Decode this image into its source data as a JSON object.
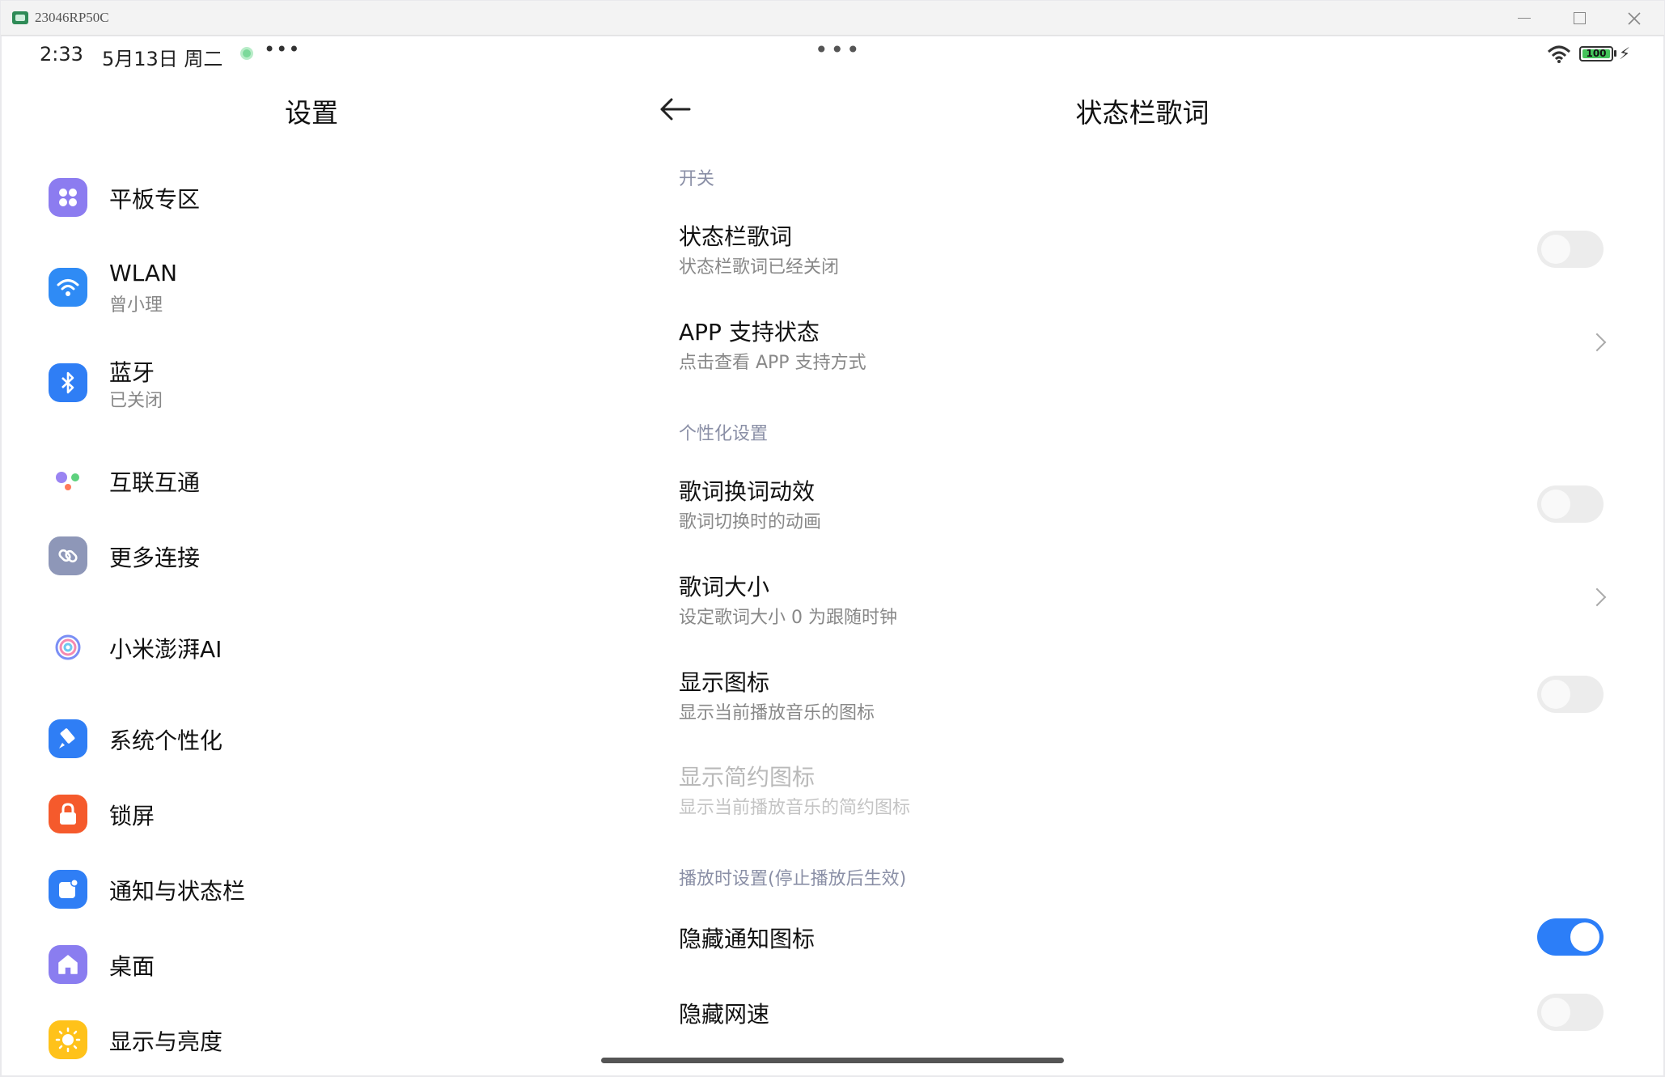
{
  "window": {
    "title": "23046RP50C"
  },
  "statusbar": {
    "time": "2:33",
    "date": "5月13日 周二",
    "dots": "•••",
    "center_dots": "•••",
    "battery": "100",
    "bolt": "⚡"
  },
  "left": {
    "title": "设置",
    "items": [
      {
        "title": "平板专区",
        "sub": "",
        "icon": "tablet-zone-icon",
        "color": "#8c7cf0"
      },
      {
        "title": "WLAN",
        "sub": "曾小理",
        "icon": "wifi-icon",
        "color": "#2f8bf5"
      },
      {
        "title": "蓝牙",
        "sub": "已关闭",
        "icon": "bluetooth-icon",
        "color": "#2f7ef5"
      },
      {
        "title": "互联互通",
        "sub": "",
        "icon": "interconnect-icon",
        "color": "#ffffff"
      },
      {
        "title": "更多连接",
        "sub": "",
        "icon": "link-icon",
        "color": "#8e97b8"
      },
      {
        "title": "小米澎湃AI",
        "sub": "",
        "icon": "ai-swirl-icon",
        "color": "#ffffff"
      },
      {
        "title": "系统个性化",
        "sub": "",
        "icon": "brush-icon",
        "color": "#2f7ef5"
      },
      {
        "title": "锁屏",
        "sub": "",
        "icon": "lock-icon",
        "color": "#f55a2c"
      },
      {
        "title": "通知与状态栏",
        "sub": "",
        "icon": "notification-icon",
        "color": "#2f7ef5"
      },
      {
        "title": "桌面",
        "sub": "",
        "icon": "home-icon",
        "color": "#8a7df0"
      },
      {
        "title": "显示与亮度",
        "sub": "",
        "icon": "sun-icon",
        "color": "#ffc21a"
      }
    ]
  },
  "right": {
    "title": "状态栏歌词",
    "sections": {
      "s1": "开关",
      "s2": "个性化设置",
      "s3": "播放时设置(停止播放后生效)"
    },
    "rows": {
      "lyrics": {
        "title": "状态栏歌词",
        "sub": "状态栏歌词已经关闭",
        "on": false
      },
      "app_support": {
        "title": "APP 支持状态",
        "sub": "点击查看 APP 支持方式"
      },
      "anim": {
        "title": "歌词换词动效",
        "sub": "歌词切换时的动画",
        "on": false
      },
      "size": {
        "title": "歌词大小",
        "sub": "设定歌词大小 0 为跟随时钟"
      },
      "show_icon": {
        "title": "显示图标",
        "sub": "显示当前播放音乐的图标",
        "on": false
      },
      "simple_icon": {
        "title": "显示简约图标",
        "sub": "显示当前播放音乐的简约图标"
      },
      "hide_notif": {
        "title": "隐藏通知图标",
        "on": true
      },
      "hide_speed": {
        "title": "隐藏网速",
        "on": false
      }
    }
  }
}
